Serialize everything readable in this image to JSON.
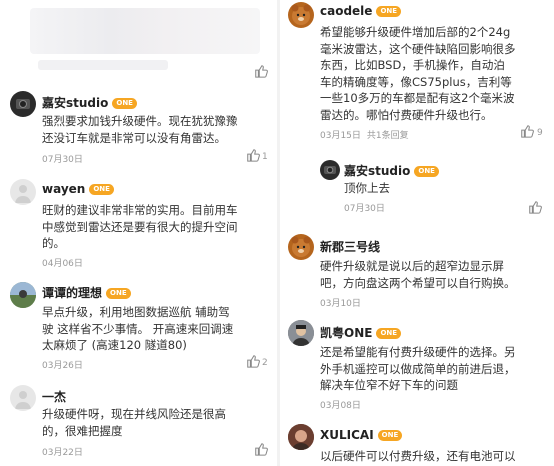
{
  "left": {
    "comments": [
      {
        "user": "嘉安studio",
        "badge": "ONE",
        "lines": [
          "强烈要求加钱升级硬件。现在犹犹豫豫",
          "还没订车就是非常可以没有角雷达。"
        ],
        "date": "07月30日",
        "likes": "1"
      },
      {
        "user": "wayen",
        "badge": "ONE",
        "lines": [
          "旺财的建议非常非常的实用。目前用车",
          "中感觉到雷达还是要有很大的提升空间",
          "的。"
        ],
        "date": "04月06日",
        "likes": ""
      },
      {
        "user": "谭谭的理想",
        "badge": "ONE",
        "lines": [
          "早点升级，利用地图数据巡航  辅助驾",
          "驶 这样省不少事情。 开高速来回调速",
          "太麻烦了  (高速120 隧道80)"
        ],
        "date": "03月26日",
        "likes": "2"
      },
      {
        "user": "一杰",
        "badge": "",
        "lines": [
          "升级硬件呀，现在并线风险还是很高",
          "的，很难把握度"
        ],
        "date": "03月22日",
        "likes": ""
      }
    ]
  },
  "right": {
    "comments": [
      {
        "user": "caodele",
        "badge": "ONE",
        "lines": [
          "希望能够升级硬件增加后部的2个24g",
          "毫米波雷达，这个硬件缺陷回影响很多",
          "东西，比如BSD，手机操作，自动泊",
          "车的精确度等，像CS75plus，吉利等",
          "一些10多万的车都是配有这2个毫米波",
          "雷达的。哪怕付费硬件升级也行。"
        ],
        "date": "03月15日",
        "reply": "共1条回复",
        "likes": "9"
      },
      {
        "user": "嘉安studio",
        "badge": "ONE",
        "lines": [
          "顶你上去"
        ],
        "date": "07月30日",
        "likes": ""
      },
      {
        "user": "新郡三号线",
        "badge": "",
        "lines": [
          "硬件升级就是说以后的超窄边显示屏",
          "吧，方向盘这两个希望可以自行购换。"
        ],
        "date": "03月10日",
        "likes": ""
      },
      {
        "user": "凯粤ONE",
        "badge": "ONE",
        "lines": [
          "还是希望能有付费升级硬件的选择。另",
          "外手机遥控可以做成简单的前进后退，",
          "解决车位窄不好下车的问题"
        ],
        "date": "03月08日",
        "likes": ""
      },
      {
        "user": "XULICAI",
        "badge": "ONE",
        "lines": [
          "以后硬件可以付费升级，还有电池可以"
        ],
        "date": "",
        "likes": ""
      }
    ]
  },
  "colors": {
    "badge": "#f6a623",
    "meta": "#999999",
    "text": "#333333"
  }
}
